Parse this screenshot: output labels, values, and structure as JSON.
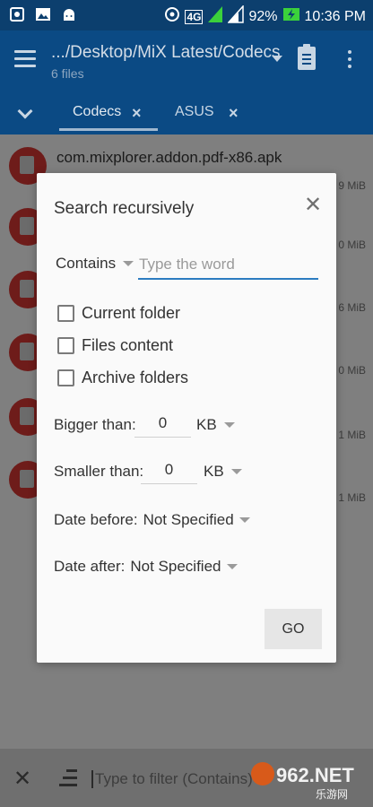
{
  "status_bar": {
    "battery": "92%",
    "time": "10:36 PM",
    "network": "4G"
  },
  "app_bar": {
    "path": ".../Desktop/MiX Latest/Codecs",
    "file_count": "6 files"
  },
  "tabs": [
    {
      "label": "Codecs",
      "active": true
    },
    {
      "label": "ASUS",
      "active": false
    }
  ],
  "files": [
    {
      "name": "com.mixplorer.addon.pdf-x86.apk",
      "size": ""
    },
    {
      "name": "",
      "size": "9 MiB"
    },
    {
      "name": "",
      "size": "0 MiB"
    },
    {
      "name": "",
      "size": "6 MiB"
    },
    {
      "name": "",
      "size": "0 MiB"
    },
    {
      "name": "",
      "size": "1 MiB"
    },
    {
      "name": "",
      "size": "1 MiB"
    }
  ],
  "dialog": {
    "title": "Search recursively",
    "match_mode": "Contains",
    "word_placeholder": "Type the word",
    "options": [
      "Current folder",
      "Files content",
      "Archive folders"
    ],
    "bigger_label": "Bigger than:",
    "bigger_value": "0",
    "bigger_unit": "KB",
    "smaller_label": "Smaller than:",
    "smaller_value": "0",
    "smaller_unit": "KB",
    "date_before_label": "Date before:",
    "date_before_value": "Not Specified",
    "date_after_label": "Date after:",
    "date_after_value": "Not Specified",
    "go_label": "GO"
  },
  "bottom_bar": {
    "filter_placeholder": "Type to filter (Contains)"
  },
  "watermark": {
    "text": "962.NET",
    "sub": "乐游网"
  },
  "colors": {
    "app_bar": "#0b4a84",
    "accent": "#2c7cc0",
    "dialog_bg": "#fafafa"
  }
}
